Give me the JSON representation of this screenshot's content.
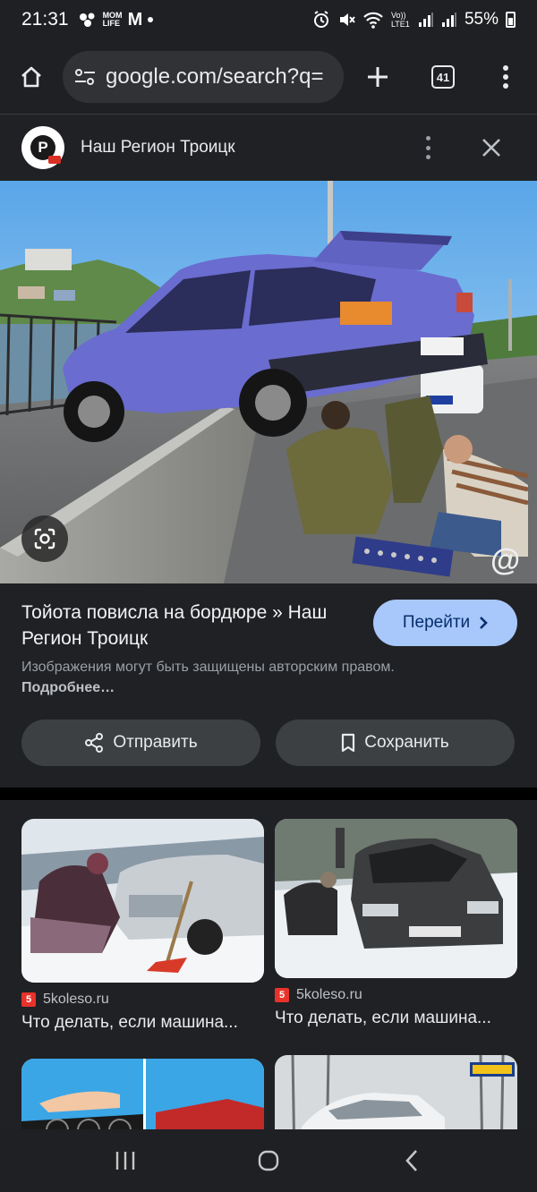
{
  "status": {
    "time": "21:31",
    "left_icons": [
      "mom-life-app-icon",
      "gmail-icon",
      "dot-icon"
    ],
    "mom_life_text": "MOM LIFE",
    "gmail_glyph": "M",
    "network_text": "Vo)) LTE1",
    "battery": "55%"
  },
  "browser": {
    "url": "google.com/search?q=",
    "tab_count": "41"
  },
  "source": {
    "title": "Наш Регион Троицк",
    "logo_letter": "P"
  },
  "result": {
    "title": "Тойота повисла на бордюре » Наш Регион Троицк",
    "visit_label": "Перейти",
    "copyright_text": "Изображения могут быть защищены авторским правом.",
    "more_link": "Подробнее…",
    "share_label": "Отправить",
    "save_label": "Сохранить"
  },
  "related": [
    {
      "source": "5koleso.ru",
      "favicon_text": "5",
      "title": "Что делать, если машина..."
    },
    {
      "source": "5koleso.ru",
      "favicon_text": "5",
      "title": "Что делать, если машина..."
    }
  ],
  "colors": {
    "background": "#202124",
    "accent": "#a8c7fa",
    "button_bg": "#3c4043"
  }
}
